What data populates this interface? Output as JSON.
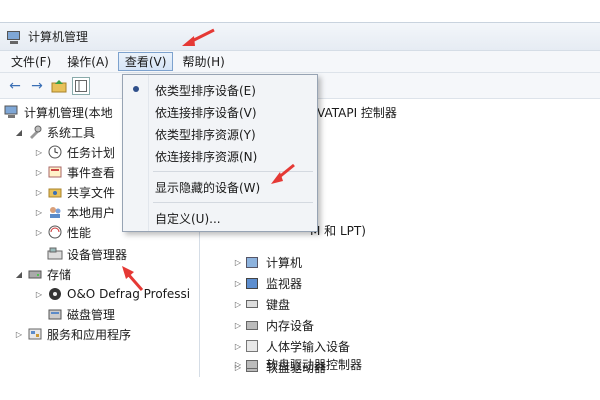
{
  "window": {
    "title": "计算机管理"
  },
  "menubar": [
    {
      "label": "文件(F)"
    },
    {
      "label": "操作(A)"
    },
    {
      "label": "查看(V)"
    },
    {
      "label": "帮助(H)"
    }
  ],
  "toolbar": {
    "back": "←",
    "forward": "→"
  },
  "dropdown": {
    "items": [
      {
        "label": "依类型排序设备(E)",
        "selected": true
      },
      {
        "label": "依连接排序设备(V)"
      },
      {
        "label": "依类型排序资源(Y)"
      },
      {
        "label": "依连接排序资源(N)"
      },
      {
        "label": "显示隐藏的设备(W)"
      },
      {
        "label": "自定义(U)..."
      }
    ]
  },
  "tree": {
    "root": "计算机管理(本地",
    "system_tools": "系统工具",
    "task_scheduler": "任务计划",
    "event_viewer": "事件查看",
    "shared_folders": "共享文件",
    "local_users": "本地用户",
    "performance": "性能",
    "device_manager": "设备管理器",
    "storage": "存储",
    "oo_defrag": "O&O Defrag Professi",
    "disk_management": "磁盘管理",
    "services_apps": "服务和应用程序"
  },
  "right": {
    "partial_ata": "VATAPI 控制器",
    "partial_ports": "M 和 LPT)",
    "devices": [
      {
        "label": "计算机",
        "icon": "computer-icon"
      },
      {
        "label": "监视器",
        "icon": "monitor-icon"
      },
      {
        "label": "键盘",
        "icon": "keyboard-icon"
      },
      {
        "label": "内存设备",
        "icon": "memory-icon"
      },
      {
        "label": "人体学输入设备",
        "icon": "hid-icon"
      },
      {
        "label": "软盘驱动器",
        "icon": "floppy-drive-icon"
      },
      {
        "label": "软盘驱动器控制器",
        "icon": "floppy-controller-icon"
      }
    ]
  },
  "colors": {
    "accent": "#3a6fb5",
    "annotation": "#e53935"
  }
}
